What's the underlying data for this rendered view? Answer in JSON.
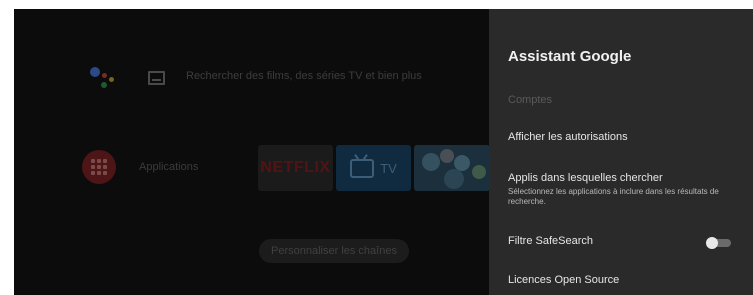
{
  "home": {
    "search_hint": "Rechercher des films, des séries TV et bien plus",
    "apps_label": "Applications",
    "netflix_label": "NETFLIX",
    "tv_label": "TV",
    "customize_button": "Personnaliser les chaînes"
  },
  "panel": {
    "title": "Assistant Google",
    "section_header": "Comptes",
    "items": [
      {
        "label": "Afficher les autorisations"
      },
      {
        "label": "Applis dans lesquelles chercher",
        "sublabel": "Sélectionnez les applications à inclure dans les résultats de recherche."
      },
      {
        "label": "Filtre SafeSearch",
        "toggle": "off"
      },
      {
        "label": "Licences Open Source"
      }
    ]
  },
  "colors": {
    "panel_bg": "#2a2a2a",
    "screen_bg": "#0c0c0c",
    "netflix_red": "#541313"
  }
}
